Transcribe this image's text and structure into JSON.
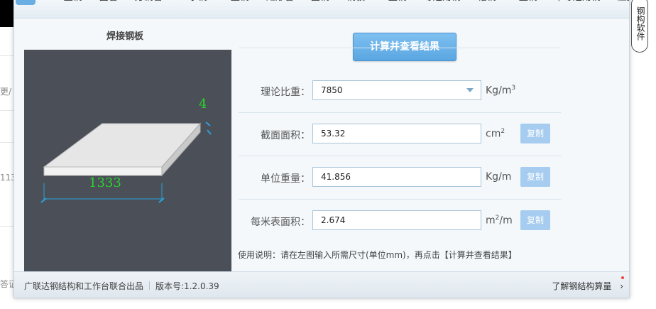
{
  "tabs": [
    "H型钢",
    "圆管",
    "方钢管",
    "工字钢",
    "C型钢",
    "矩形管",
    "圆钢",
    "钢板",
    "Z型钢",
    "等边角钢",
    "槽钢",
    "T型钢",
    "不等边角钢",
    "压型钢板"
  ],
  "shape": {
    "title": "焊接钢板",
    "thickness_label": "4",
    "width_label": "1333"
  },
  "calc_button": "计算并查看结果",
  "rows": [
    {
      "label": "理论比重：",
      "value": "7850",
      "unit": "Kg/m",
      "unit_sup": "3",
      "copy": ""
    },
    {
      "label": "截面面积：",
      "value": "53.32",
      "unit": "cm",
      "unit_sup": "2",
      "copy": "复制"
    },
    {
      "label": "单位重量：",
      "value": "41.856",
      "unit": "Kg/m",
      "unit_sup": "",
      "copy": "复制"
    },
    {
      "label": "每米表面积：",
      "value": "2.674",
      "unit": "m",
      "unit_sup": "2",
      "unit_after": "/m",
      "copy": "复制"
    }
  ],
  "instructions": "使用说明：请在左图输入所需尺寸(单位mm)，再点击【计算并查看结果】",
  "footer": {
    "credit": "广联达钢结构和工作台联合出品",
    "version": "版本号:1.2.0.39",
    "learn_more": "了解钢结构算量"
  },
  "side_widget": "钢构软件",
  "background": {
    "text1": "更/",
    "text2": "113",
    "text3": "答证"
  },
  "colors": {
    "accent": "#5aa6e2",
    "copy_button": "#a6cdf0",
    "canvas": "#4a4f58",
    "dimension_text": "#2bd52b",
    "dimension_line": "#29a3d9"
  }
}
